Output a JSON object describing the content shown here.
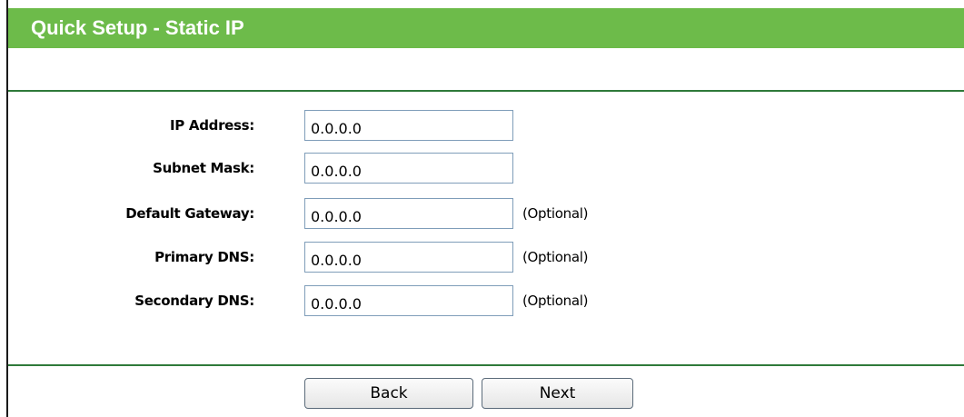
{
  "header": {
    "title": "Quick Setup - Static IP"
  },
  "form": {
    "fields": [
      {
        "label": "IP Address:",
        "value": "0.0.0.0",
        "hint": ""
      },
      {
        "label": "Subnet Mask:",
        "value": "0.0.0.0",
        "hint": ""
      },
      {
        "label": "Default Gateway:",
        "value": "0.0.0.0",
        "hint": "(Optional)"
      },
      {
        "label": "Primary DNS:",
        "value": "0.0.0.0",
        "hint": "(Optional)"
      },
      {
        "label": "Secondary DNS:",
        "value": "0.0.0.0",
        "hint": "(Optional)"
      }
    ]
  },
  "buttons": {
    "back_label": "Back",
    "next_label": "Next"
  },
  "colors": {
    "title_bar": "#6dbb4a",
    "rule": "#2f7a3a",
    "input_border": "#7f9db9"
  }
}
